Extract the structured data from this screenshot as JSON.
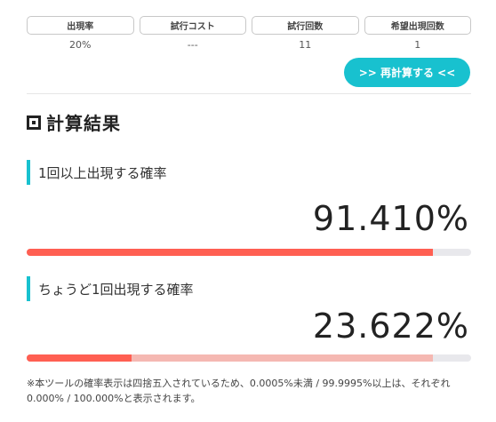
{
  "params": [
    {
      "label": "出現率",
      "value": "20%"
    },
    {
      "label": "試行コスト",
      "value": "---"
    },
    {
      "label": "試行回数",
      "value": "11"
    },
    {
      "label": "希望出現回数",
      "value": "1"
    }
  ],
  "recalc_button": ">> 再計算する <<",
  "section_title": "計算結果",
  "results": [
    {
      "heading": "1回以上出現する確率",
      "value": "91.410%",
      "probability": 0.9141
    },
    {
      "heading": "ちょうど1回出現する確率",
      "value": "23.622%",
      "probability": 0.23622,
      "secondary_probability": 0.9141
    }
  ],
  "note": "※本ツールの確率表示は四捨五入されているため、0.0005%未満 / 99.9995%以上は、それぞれ 0.000% / 100.000%と表示されます。",
  "colors": {
    "accent": "#18c1cf",
    "bar_fill": "#ff5f52",
    "bar_fill_light": "#f5b8b2",
    "bar_track": "#e8e8ec"
  }
}
